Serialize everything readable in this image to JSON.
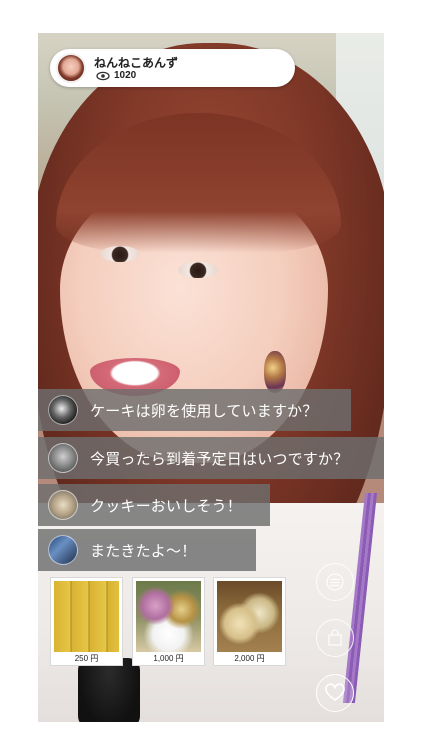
{
  "header": {
    "streamer_name": "ねんねこあんず",
    "view_count": "1020",
    "avatar_icon": "streamer-avatar",
    "views_icon": "eye-icon"
  },
  "comments": [
    {
      "avatar": "cat-avatar",
      "text": "ケーキは卵を使用していますか？"
    },
    {
      "avatar": "person-avatar",
      "text": "今買ったら到着予定日はいつですか？"
    },
    {
      "avatar": "dog-avatar",
      "text": "クッキーおいしそう！"
    },
    {
      "avatar": "blue-avatar",
      "text": "またきたよ〜！"
    }
  ],
  "products": [
    {
      "price": "250 円",
      "image": "yellow-gift-boxes"
    },
    {
      "price": "1,000 円",
      "image": "flower-pot-gifts"
    },
    {
      "price": "2,000 円",
      "image": "cookie-assortment-box"
    }
  ],
  "actions": [
    {
      "icon": "menu-icon"
    },
    {
      "icon": "bag-icon"
    },
    {
      "icon": "heart-icon"
    }
  ],
  "colors": {
    "comment_bg": "#6e6e6e",
    "comment_text": "#ffffff",
    "header_bg": "#ffffff"
  }
}
